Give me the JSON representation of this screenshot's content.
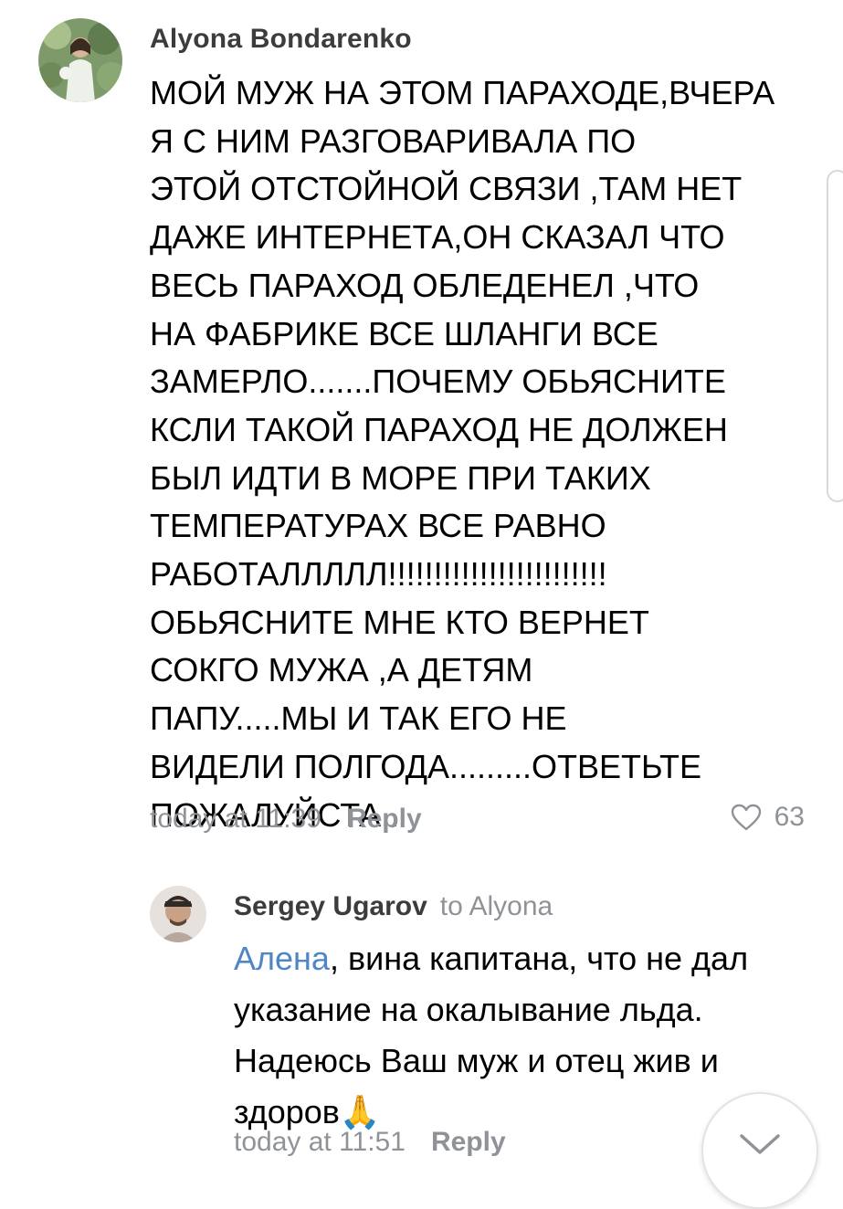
{
  "comment": {
    "author": "Alyona Bondarenko",
    "text_lines": [
      "МОЙ МУЖ НА ЭТОМ ПАРАХОДЕ,ВЧЕРА",
      "Я С НИМ РАЗГОВАРИВАЛА ПО",
      "ЭТОЙ ОТСТОЙНОЙ СВЯЗИ ,ТАМ НЕТ",
      "ДАЖЕ ИНТЕРНЕТА,ОН СКАЗАЛ ЧТО",
      "ВЕСЬ ПАРАХОД ОБЛЕДЕНЕЛ ,ЧТО",
      "НА ФАБРИКЕ ВСЕ ШЛАНГИ ВСЕ",
      "ЗАМЕРЛО.......ПОЧЕМУ ОБЬЯСНИТЕ",
      "КСЛИ ТАКОЙ ПАРАХОД НЕ ДОЛЖЕН",
      "БЫЛ ИДТИ В МОРЕ ПРИ ТАКИХ",
      "ТЕМПЕРАТУРАХ ВСЕ РАВНО",
      "РАБОТАЛЛЛЛЛ!!!!!!!!!!!!!!!!!!!!!!!!",
      "ОБЬЯСНИТЕ МНЕ КТО ВЕРНЕТ",
      "СОКГО МУЖА ,А ДЕТЯМ",
      "ПАПУ.....МЫ И ТАК ЕГО НЕ",
      "ВИДЕЛИ ПОЛГОДА.........ОТВЕТЬТЕ",
      "ПОЖАЛУЙСТА.."
    ],
    "time": "today at 11:39",
    "reply_label": "Reply",
    "likes": "63",
    "like_icon": "heart-outline-icon"
  },
  "reply": {
    "author": "Sergey Ugarov",
    "to_prefix": "to",
    "to_name": "Alyona",
    "mention": "Алена",
    "text_lines": [
      ", вина капитана, что не дал",
      "указание на окалывание льда.",
      "Надеюсь Ваш муж и отец жив и",
      "здоров"
    ],
    "emoji": "🙏",
    "time": "today at 11:51",
    "reply_label": "Reply"
  },
  "colors": {
    "meta_gray": "#8f9398",
    "author_dark": "#3c3c3c",
    "link_blue": "#4f86c6"
  },
  "scroll_down_icon": "chevron-down-icon"
}
